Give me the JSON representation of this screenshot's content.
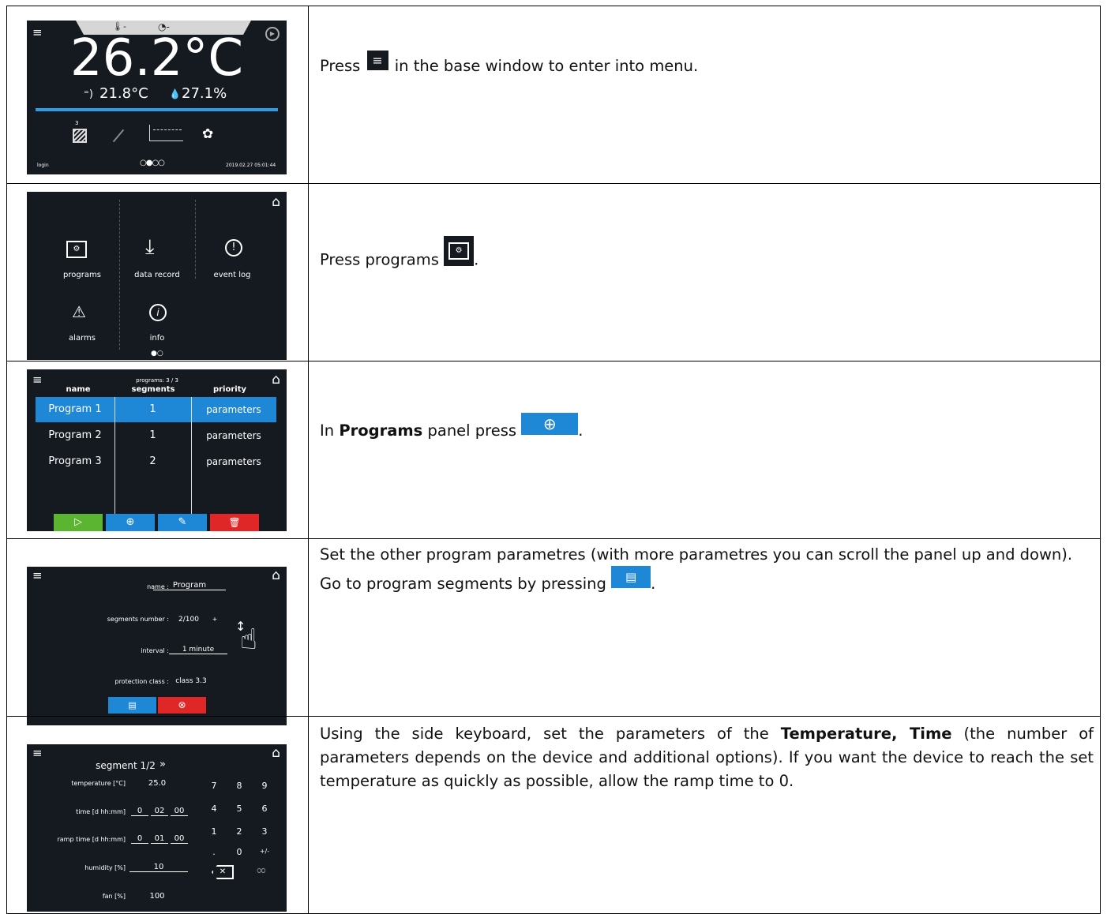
{
  "rows": [
    {
      "screen": {
        "temperature": "26.2°C",
        "sensor_temp": "21.8°C",
        "humidity": "27.1%",
        "segment_num": "3",
        "login": "login",
        "datetime": "2019.02.27 05:01:44"
      },
      "text": {
        "before": "Press",
        "after": "in the base window to enter into menu."
      }
    },
    {
      "screen": {
        "items": [
          "programs",
          "data record",
          "event log",
          "alarms",
          "info"
        ]
      },
      "text": {
        "before": "Press programs",
        "after": "."
      }
    },
    {
      "screen": {
        "count": "programs: 3 / 3",
        "headers": [
          "name",
          "segments",
          "priority"
        ],
        "programs": [
          {
            "name": "Program 1",
            "segments": "1",
            "priority": "parameters"
          },
          {
            "name": "Program 2",
            "segments": "1",
            "priority": "parameters"
          },
          {
            "name": "Program 3",
            "segments": "2",
            "priority": "parameters"
          }
        ]
      },
      "text": {
        "before": "In",
        "bold": "Programs",
        "middle": "panel press",
        "after": "."
      }
    },
    {
      "screen": {
        "name_label": "name :",
        "name_value": "Program",
        "segments_label": "segments number :",
        "segments_minus": "-",
        "segments_value": "2/100",
        "segments_plus": "+",
        "interval_label": "interval :",
        "interval_value": "1 minute",
        "protection_label": "protection class :",
        "protection_value": "class 3.3"
      },
      "text": {
        "p1": "Set the other program parametres (with more parametres you can scroll the panel up and down).",
        "p2_before": "Go to program segments by pressing",
        "p2_after": "."
      }
    },
    {
      "screen": {
        "title": "segment 1/2",
        "arrows": "»",
        "temp_label": "temperature [°C]",
        "temp_value": "25.0",
        "time_label": "time [d hh:mm]",
        "time_d": "0",
        "time_h": "02",
        "time_m": "00",
        "ramp_label": "ramp time [d hh:mm]",
        "ramp_d": "0",
        "ramp_h": "01",
        "ramp_m": "00",
        "hum_label": "humidity [%]",
        "hum_value": "10",
        "fan_label": "fan [%]",
        "fan_value": "100",
        "keys": [
          "7",
          "8",
          "9",
          "4",
          "5",
          "6",
          "1",
          "2",
          "3",
          ".",
          "0",
          "+/-"
        ],
        "infinity": "∞"
      },
      "text": {
        "before": "Using the side keyboard, set the parameters of the",
        "bold": "Temperature, Time",
        "after": " (the number of parameters depends on the device and additional options). If you want the device to reach the set temperature  as quickly as possible, allow the ramp time to 0."
      }
    }
  ]
}
